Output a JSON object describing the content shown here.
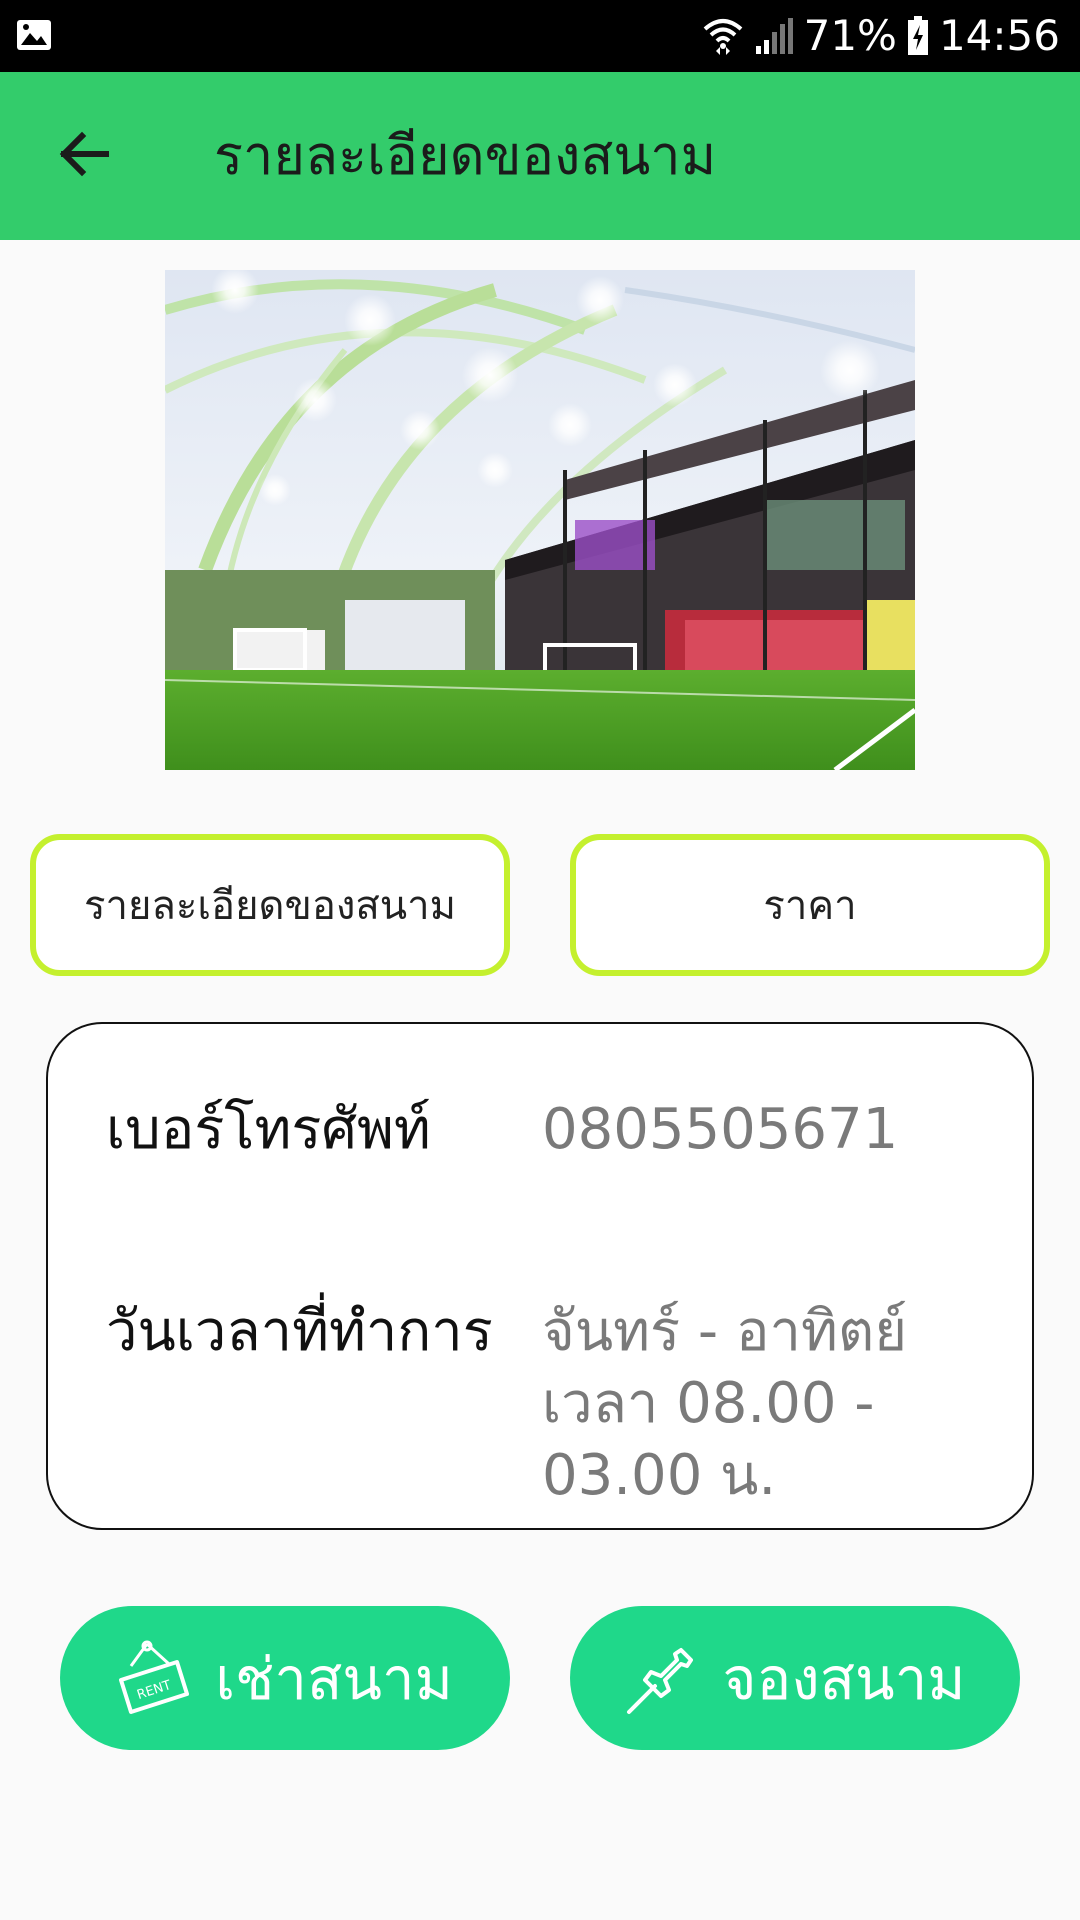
{
  "status_bar": {
    "battery_percent": "71%",
    "time": "14:56",
    "icons": [
      "gallery-icon",
      "wifi-icon",
      "signal-icon",
      "battery-charging-icon"
    ]
  },
  "app_bar": {
    "title": "รายละเอียดของสนาม",
    "back_icon": "arrow-left-icon"
  },
  "hero_image": {
    "subject": "indoor-football-field-photo"
  },
  "tabs": {
    "details_label": "รายละเอียดของสนาม",
    "price_label": "ราคา"
  },
  "info": {
    "phone_label": "เบอร์โทรศัพท์",
    "phone_value": "0805505671",
    "hours_label": "วันเวลาที่ทำการ",
    "hours_line1": "จันทร์ - อาทิตย์",
    "hours_line2": "เวลา 08.00 -",
    "hours_line3": "03.00 น."
  },
  "actions": {
    "rent_label": "เช่าสนาม",
    "rent_icon": "rent-sign-icon",
    "rent_sign_text": "RENT",
    "book_label": "จองสนาม",
    "book_icon": "pushpin-icon"
  },
  "colors": {
    "app_bar": "#33cc6b",
    "tab_border": "#c4f02e",
    "action_button": "#1fd88a",
    "status_bar": "#000000",
    "value_text": "#7a7a7a"
  }
}
